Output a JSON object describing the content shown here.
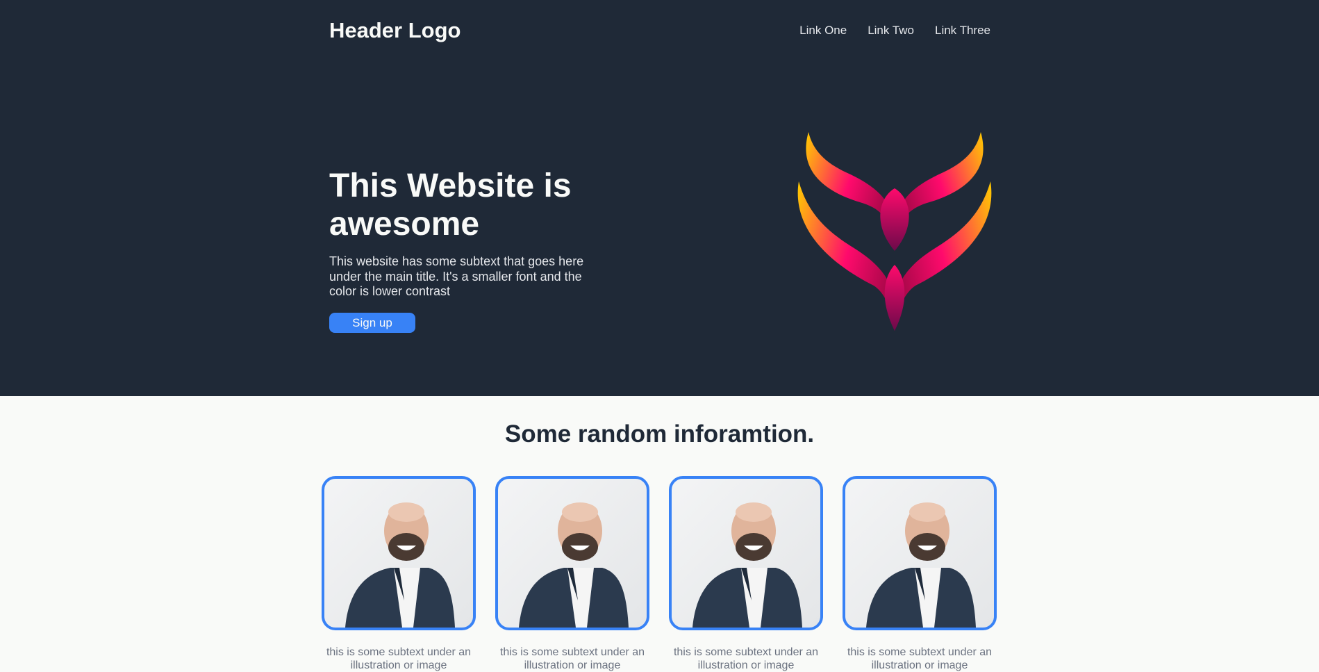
{
  "header": {
    "logo": "Header Logo",
    "links": [
      "Link One",
      "Link Two",
      "Link Three"
    ]
  },
  "hero": {
    "title": "This Website is awesome",
    "subtitle": "This website has some subtext that goes here under the main title. It's a smaller font and the color is lower contrast",
    "cta_label": "Sign up"
  },
  "info": {
    "title": "Some random inforamtion.",
    "cards": [
      {
        "caption": "this is some subtext under an illustration or image"
      },
      {
        "caption": "this is some subtext under an illustration or image"
      },
      {
        "caption": "this is some subtext under an illustration or image"
      },
      {
        "caption": "this is some subtext under an illustration or image"
      }
    ]
  },
  "colors": {
    "hero_bg": "#1f2937",
    "accent": "#3882f6",
    "page_bg": "#f9faf8",
    "logo_gradient": [
      "#ffcc00",
      "#ff0a6c",
      "#6c0a4a"
    ]
  },
  "icons": {
    "hero_image": "flame-wings-logo",
    "card_image": "smiling-bald-man-photo"
  }
}
